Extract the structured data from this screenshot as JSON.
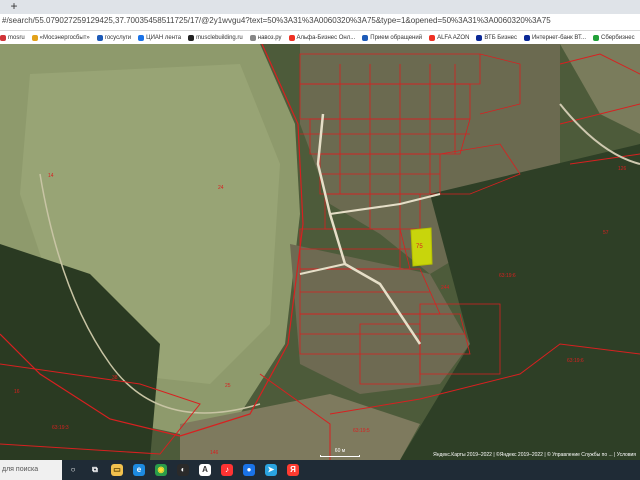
{
  "browser": {
    "new_tab_glyph": "+",
    "url": "#/search/55.079027259129425,37.70035458511725/17/@2y1wvgu4?text=50%3A31%3A0060320%3A75&type=1&opened=50%3A31%3A0060320%3A75",
    "bookmarks": [
      {
        "label": "mosru",
        "color": "#d13438"
      },
      {
        "label": "«Мосэнергосбыт»",
        "color": "#e3a21a"
      },
      {
        "label": "госуслуги",
        "color": "#1e5bb8"
      },
      {
        "label": "ЦИАН лента",
        "color": "#1a73e8"
      },
      {
        "label": "musclebuilding.ru",
        "color": "#222222"
      },
      {
        "label": "навоз.ру",
        "color": "#888888"
      },
      {
        "label": "Альфа-Бизнес Онл...",
        "color": "#ef3124"
      },
      {
        "label": "Прием обращений",
        "color": "#1e5bb8"
      },
      {
        "label": "ALFA AZON",
        "color": "#ef3124"
      },
      {
        "label": "ВТБ Бизнес",
        "color": "#0a2896"
      },
      {
        "label": "Интернет-банк ВТ...",
        "color": "#0a2896"
      },
      {
        "label": "Сбербизнес",
        "color": "#21a038"
      }
    ]
  },
  "map": {
    "parcels": [
      {
        "label": "14",
        "color": "#d82020"
      },
      {
        "label": "24",
        "color": "#d82020"
      },
      {
        "label": "16",
        "color": "#d82020"
      },
      {
        "label": "25",
        "color": "#d82020"
      },
      {
        "label": "38",
        "color": "#d82020"
      },
      {
        "label": "146",
        "color": "#d82020"
      },
      {
        "label": "57",
        "color": "#d82020"
      },
      {
        "label": "126",
        "color": "#d82020"
      },
      {
        "label": "75",
        "color": "#d82020"
      },
      {
        "label": "244",
        "color": "#d82020"
      },
      {
        "label": "63:19:6",
        "color": "#d82020"
      },
      {
        "label": "63:19:6",
        "color": "#d82020"
      },
      {
        "label": "63:19:5",
        "color": "#d82020"
      },
      {
        "label": "63:19:3",
        "color": "#d82020"
      }
    ],
    "highlight_label": "75",
    "scale_text": "60 м",
    "attribution": "Яндекс.Карты 2019–2022 | ©Яндекс 2019–2022 | © Управление Службы по ... | Условия"
  },
  "taskbar": {
    "search_text": "для поиска",
    "apps": [
      {
        "name": "search-circle-icon",
        "glyph": "○",
        "color": "transparent",
        "fg": "#ffffff"
      },
      {
        "name": "task-view-icon",
        "glyph": "⧉",
        "color": "transparent",
        "fg": "#ffffff"
      },
      {
        "name": "explorer-icon",
        "glyph": "▭",
        "color": "#f2c14e",
        "fg": "#5a4100"
      },
      {
        "name": "edge-icon",
        "glyph": "e",
        "color": "#1d8ae0",
        "fg": "#ffffff"
      },
      {
        "name": "chrome-icon",
        "glyph": "◉",
        "color": "#2a9d4a",
        "fg": "#ffdd33"
      },
      {
        "name": "media-icon",
        "glyph": "◐",
        "color": "#2a2a2a",
        "fg": "#ffffff"
      },
      {
        "name": "app-icon",
        "glyph": "A",
        "color": "#ffffff",
        "fg": "#333333"
      },
      {
        "name": "yandex-music-icon",
        "glyph": "♪",
        "color": "#ff3333",
        "fg": "#ffffff"
      },
      {
        "name": "browser-icon",
        "glyph": "●",
        "color": "#1a73e8",
        "fg": "#ffffff"
      },
      {
        "name": "telegram-icon",
        "glyph": "➤",
        "color": "#2aa3e0",
        "fg": "#ffffff"
      },
      {
        "name": "yandex-browser-icon",
        "glyph": "Я",
        "color": "#ff3b30",
        "fg": "#ffffff"
      }
    ]
  }
}
